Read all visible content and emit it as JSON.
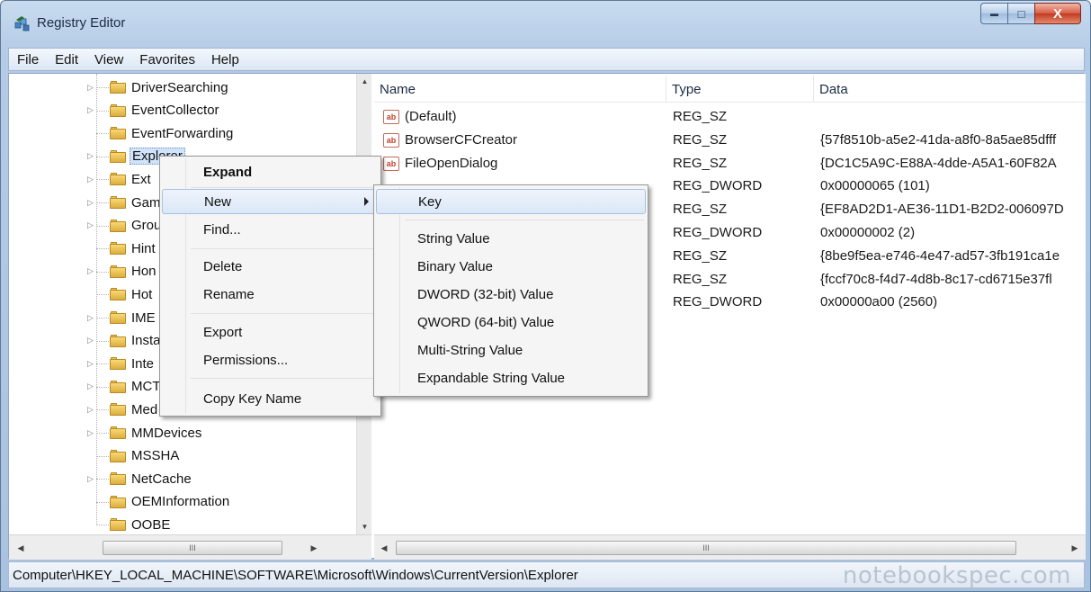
{
  "window": {
    "title": "Registry Editor",
    "buttons": {
      "minimize": "▬",
      "maximize": "□",
      "close": "X"
    }
  },
  "menubar": [
    "File",
    "Edit",
    "View",
    "Favorites",
    "Help"
  ],
  "tree": {
    "items": [
      {
        "label": "DriverSearching",
        "expandable": true
      },
      {
        "label": "EventCollector",
        "expandable": true
      },
      {
        "label": "EventForwarding",
        "expandable": false
      },
      {
        "label": "Explorer",
        "expandable": true,
        "selected": true
      },
      {
        "label": "Ext",
        "expandable": true
      },
      {
        "label": "Gam",
        "expandable": true
      },
      {
        "label": "Grou",
        "expandable": true
      },
      {
        "label": "Hint",
        "expandable": false
      },
      {
        "label": "Hon",
        "expandable": true
      },
      {
        "label": "Hot",
        "expandable": false
      },
      {
        "label": "IME",
        "expandable": true
      },
      {
        "label": "Insta",
        "expandable": true
      },
      {
        "label": "Inte",
        "expandable": true
      },
      {
        "label": "MCT",
        "expandable": true
      },
      {
        "label": "Med",
        "expandable": true
      },
      {
        "label": "MMDevices",
        "expandable": true
      },
      {
        "label": "MSSHA",
        "expandable": false
      },
      {
        "label": "NetCache",
        "expandable": true
      },
      {
        "label": "OEMInformation",
        "expandable": false
      },
      {
        "label": "OOBE",
        "expandable": false
      }
    ],
    "hscroll_thumb": "III"
  },
  "list": {
    "columns": {
      "name": "Name",
      "type": "Type",
      "data": "Data"
    },
    "rows": [
      {
        "name": "(Default)",
        "type": "REG_SZ",
        "data": ""
      },
      {
        "name": "BrowserCFCreator",
        "type": "REG_SZ",
        "data": "{57f8510b-a5e2-41da-a8f0-8a5ae85dfff"
      },
      {
        "name": "FileOpenDialog",
        "type": "REG_SZ",
        "data": "{DC1C5A9C-E88A-4dde-A5A1-60F82A"
      },
      {
        "name": "",
        "type": "REG_DWORD",
        "data": "0x00000065 (101)"
      },
      {
        "name": "",
        "type": "REG_SZ",
        "data": "{EF8AD2D1-AE36-11D1-B2D2-006097D"
      },
      {
        "name": "",
        "type": "REG_DWORD",
        "data": "0x00000002 (2)"
      },
      {
        "name": "",
        "type": "REG_SZ",
        "data": "{8be9f5ea-e746-4e47-ad57-3fb191ca1e"
      },
      {
        "name": "",
        "type": "REG_SZ",
        "data": "{fccf70c8-f4d7-4d8b-8c17-cd6715e37fl"
      },
      {
        "name": "",
        "type": "REG_DWORD",
        "data": "0x00000a00 (2560)"
      }
    ],
    "hscroll_thumb": "III"
  },
  "context_menu": {
    "expand": "Expand",
    "new": "New",
    "find": "Find...",
    "delete": "Delete",
    "rename": "Rename",
    "export": "Export",
    "permissions": "Permissions...",
    "copy_key_name": "Copy Key Name"
  },
  "submenu": {
    "key": "Key",
    "string_value": "String Value",
    "binary_value": "Binary Value",
    "dword_value": "DWORD (32-bit) Value",
    "qword_value": "QWORD (64-bit) Value",
    "multi_string_value": "Multi-String Value",
    "expandable_string_value": "Expandable String Value"
  },
  "statusbar": {
    "path": "Computer\\HKEY_LOCAL_MACHINE\\SOFTWARE\\Microsoft\\Windows\\CurrentVersion\\Explorer",
    "watermark": "notebookspec.com"
  }
}
